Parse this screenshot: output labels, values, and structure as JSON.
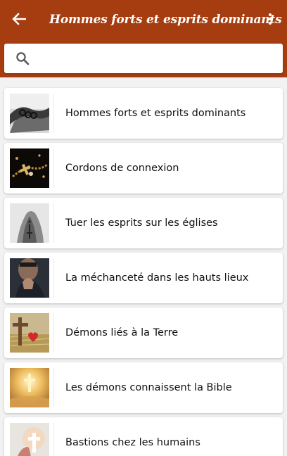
{
  "appbar": {
    "title": "Hommes forts et esprits dominants",
    "back_icon": "arrow-left-icon",
    "menu_icon": "more-vertical-icon",
    "color": "#a63d10"
  },
  "search": {
    "placeholder": "",
    "value": "",
    "icon": "search-icon"
  },
  "items": [
    {
      "label": "Hommes forts et esprits dominants",
      "thumb": "chains-hands"
    },
    {
      "label": "Cordons de connexion",
      "thumb": "rosary-dark"
    },
    {
      "label": "Tuer les esprits sur les églises",
      "thumb": "praying-hands-rosary"
    },
    {
      "label": "La méchanceté dans les hauts lieux",
      "thumb": "praying-man"
    },
    {
      "label": "Démons liés à la Terre",
      "thumb": "cross-heart-straw"
    },
    {
      "label": "Les démons connaissent la Bible",
      "thumb": "golden-cross"
    },
    {
      "label": "Bastions chez les humains",
      "thumb": "light-cross"
    }
  ]
}
